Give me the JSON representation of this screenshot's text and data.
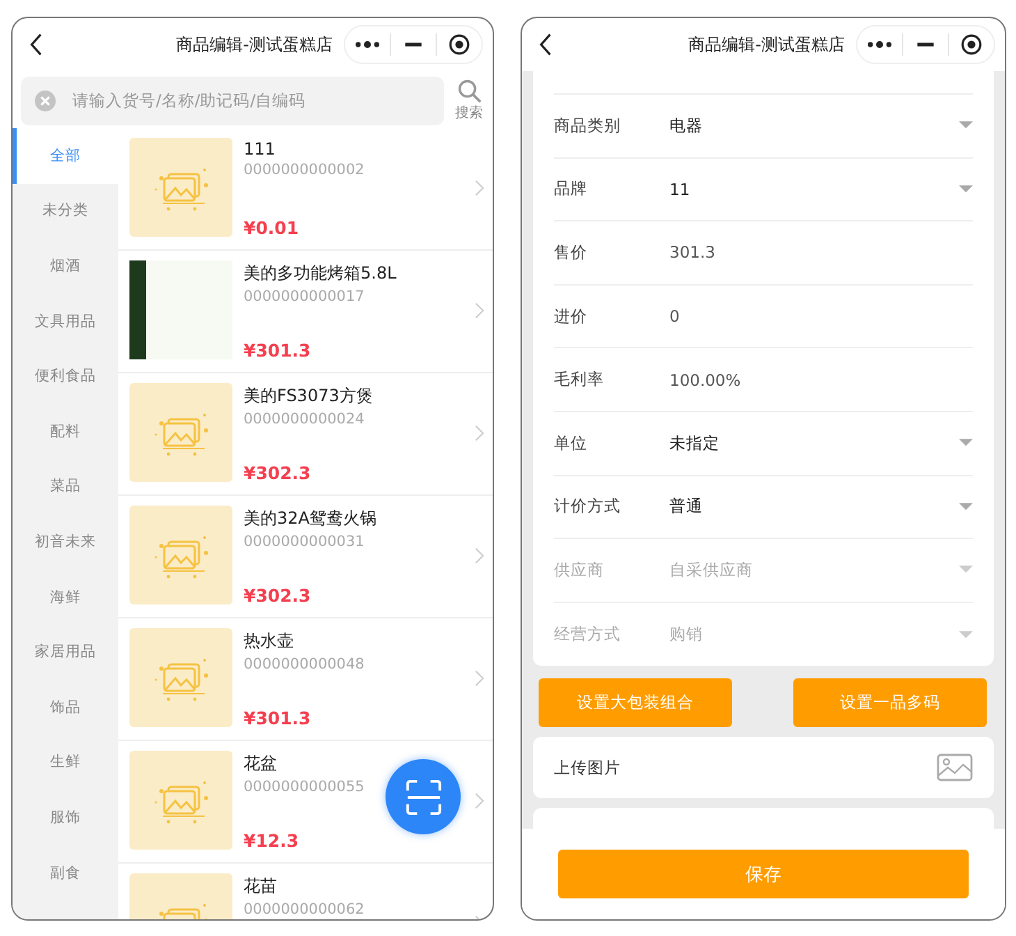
{
  "left_window": {
    "title": "商品编辑-测试蛋糕店",
    "search": {
      "placeholder": "请输入货号/名称/助记码/自编码",
      "button": "搜索"
    },
    "categories": [
      {
        "label": "全部",
        "selected": true
      },
      {
        "label": "未分类",
        "selected": false
      },
      {
        "label": "烟酒",
        "selected": false
      },
      {
        "label": "文具用品",
        "selected": false
      },
      {
        "label": "便利食品",
        "selected": false
      },
      {
        "label": "配料",
        "selected": false
      },
      {
        "label": "菜品",
        "selected": false
      },
      {
        "label": "初音未来",
        "selected": false
      },
      {
        "label": "海鲜",
        "selected": false
      },
      {
        "label": "家居用品",
        "selected": false
      },
      {
        "label": "饰品",
        "selected": false
      },
      {
        "label": "生鲜",
        "selected": false
      },
      {
        "label": "服饰",
        "selected": false
      },
      {
        "label": "副食",
        "selected": false
      }
    ],
    "products": [
      {
        "kind": "placeholder",
        "name": "111",
        "code": "0000000000002",
        "price": "¥0.01"
      },
      {
        "kind": "photo",
        "name": "美的多功能烤箱5.8L",
        "code": "0000000000017",
        "price": "¥301.3"
      },
      {
        "kind": "placeholder",
        "name": "美的FS3073方煲",
        "code": "0000000000024",
        "price": "¥302.3"
      },
      {
        "kind": "placeholder",
        "name": "美的32A鸳鸯火锅",
        "code": "0000000000031",
        "price": "¥302.3"
      },
      {
        "kind": "placeholder",
        "name": "热水壶",
        "code": "0000000000048",
        "price": "¥301.3"
      },
      {
        "kind": "placeholder",
        "name": "花盆",
        "code": "0000000000055",
        "price": "¥12.3"
      },
      {
        "kind": "placeholder",
        "name": "花苗",
        "code": "0000000000062"
      }
    ]
  },
  "right_window": {
    "title": "商品编辑-测试蛋糕店",
    "fields": [
      {
        "kind": "select",
        "label": "商品类别",
        "value": "电器",
        "disabled": false
      },
      {
        "kind": "select",
        "label": "品牌",
        "value": "11",
        "disabled": false
      },
      {
        "kind": "text",
        "label": "售价",
        "value": "301.3",
        "disabled": false
      },
      {
        "kind": "text",
        "label": "进价",
        "value": "0",
        "disabled": false
      },
      {
        "kind": "text",
        "label": "毛利率",
        "value": "100.00%",
        "disabled": false
      },
      {
        "kind": "select",
        "label": "单位",
        "value": "未指定",
        "disabled": false
      },
      {
        "kind": "select",
        "label": "计价方式",
        "value": "普通",
        "disabled": false
      },
      {
        "kind": "select",
        "label": "供应商",
        "value": "自采供应商",
        "disabled": true
      },
      {
        "kind": "select",
        "label": "经营方式",
        "value": "购销",
        "disabled": true
      }
    ],
    "buttons": [
      "设置大包装组合",
      "设置一品多码"
    ],
    "upload": {
      "label": "上传图片"
    },
    "save_button": "保存"
  }
}
